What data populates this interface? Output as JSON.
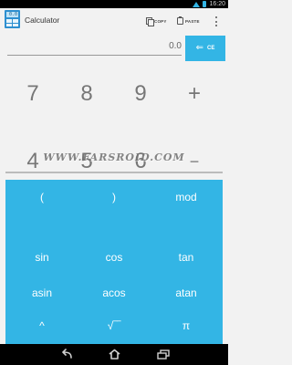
{
  "status_bar": {
    "time": "16:20",
    "colors": {
      "icons": "#33b5e5",
      "background": "#000000"
    }
  },
  "action_bar": {
    "app_icon_display": "0.0",
    "title": "Calculator",
    "copy_label": "COPY",
    "paste_label": "PASTE",
    "overflow_icon": "overflow-menu-icon"
  },
  "display": {
    "value": "0.0",
    "backspace_label": "CE",
    "backspace_icon": "backspace-arrow-icon"
  },
  "keypad": {
    "row1": [
      "7",
      "8",
      "9",
      "+"
    ],
    "row2": [
      "4",
      "5",
      "6",
      "−"
    ]
  },
  "watermark": "WWW.FARSROID.COM",
  "advanced_panel": {
    "row1": [
      "(",
      ")",
      "mod"
    ],
    "row2": [
      "sin",
      "cos",
      "tan"
    ],
    "row3": [
      "asin",
      "acos",
      "atan"
    ],
    "row4": [
      "^",
      "√‾‾",
      "π"
    ]
  },
  "colors": {
    "accent": "#33b5e5",
    "background": "#f2f2f2",
    "digit_text": "#777777"
  },
  "nav_bar": {
    "back_icon": "back-icon",
    "home_icon": "home-icon",
    "recent_icon": "recent-apps-icon"
  }
}
